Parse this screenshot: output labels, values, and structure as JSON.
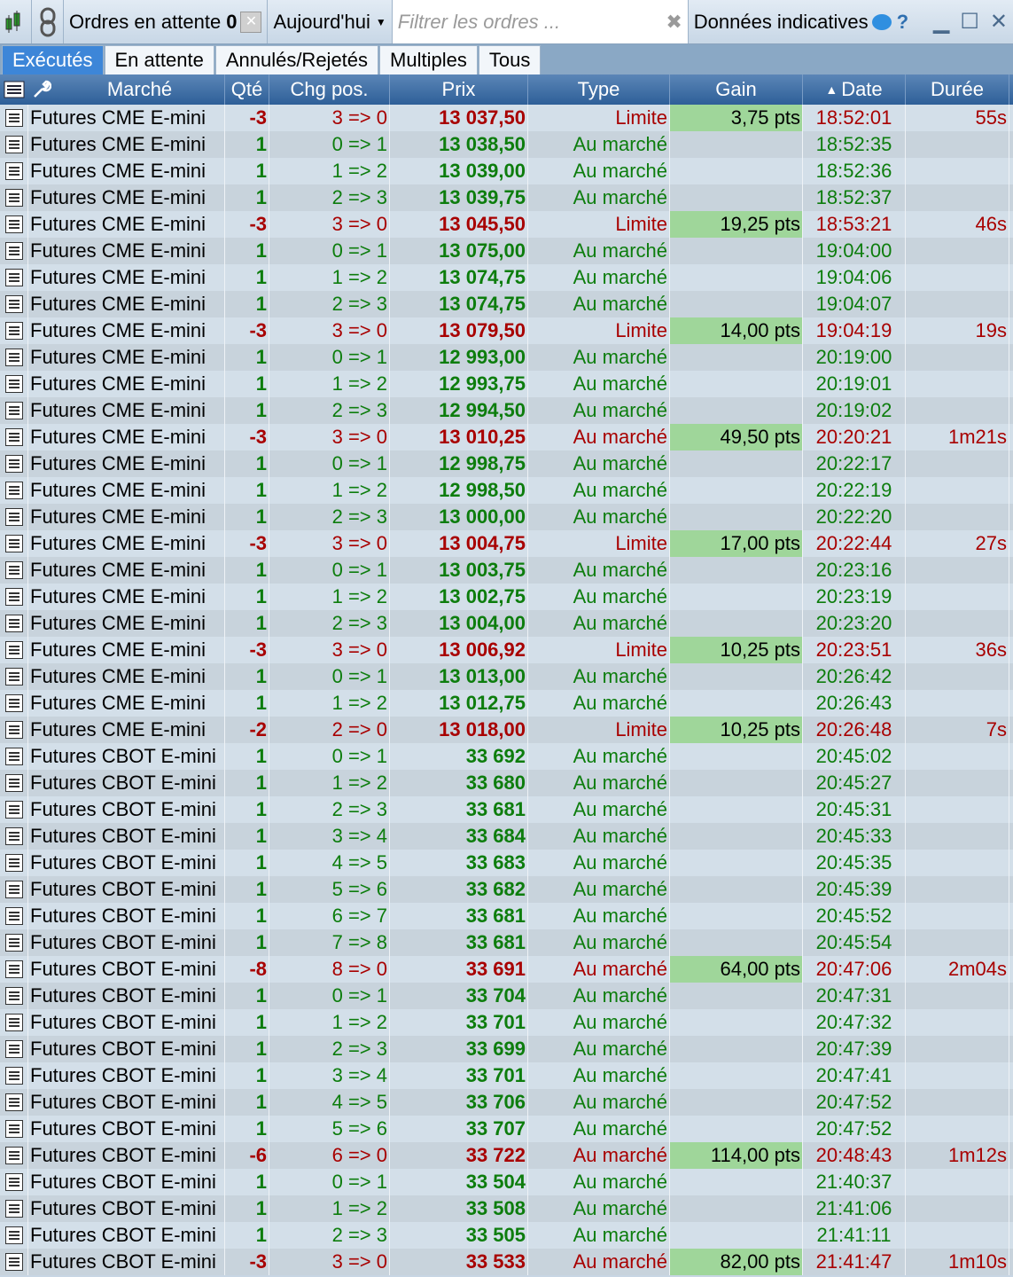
{
  "toolbar": {
    "pending_label": "Ordres en attente",
    "pending_count": "0",
    "period": "Aujourd'hui",
    "filter_placeholder": "Filtrer les ordres ...",
    "indicative": "Données indicatives"
  },
  "tabs": [
    "Exécutés",
    "En attente",
    "Annulés/Rejetés",
    "Multiples",
    "Tous"
  ],
  "columns": [
    "Marché",
    "Qté",
    "Chg pos.",
    "Prix",
    "Type",
    "Gain",
    "Date",
    "Durée"
  ],
  "sort_indicator": "▲",
  "colors": {
    "buy": "#0d7d0d",
    "sell": "#a80000",
    "gain_bg": "#9fd69a",
    "active_tab": "#3d86d8"
  },
  "rows": [
    {
      "market": "Futures CME E-mini",
      "qty": "-3",
      "chg": "3 => 0",
      "price": "13 037,50",
      "type": "Limite",
      "gain": "3,75 pts",
      "date": "18:52:01",
      "dur": "55s"
    },
    {
      "market": "Futures CME E-mini",
      "qty": "1",
      "chg": "0 => 1",
      "price": "13 038,50",
      "type": "Au marché",
      "gain": "",
      "date": "18:52:35",
      "dur": ""
    },
    {
      "market": "Futures CME E-mini",
      "qty": "1",
      "chg": "1 => 2",
      "price": "13 039,00",
      "type": "Au marché",
      "gain": "",
      "date": "18:52:36",
      "dur": ""
    },
    {
      "market": "Futures CME E-mini",
      "qty": "1",
      "chg": "2 => 3",
      "price": "13 039,75",
      "type": "Au marché",
      "gain": "",
      "date": "18:52:37",
      "dur": ""
    },
    {
      "market": "Futures CME E-mini",
      "qty": "-3",
      "chg": "3 => 0",
      "price": "13 045,50",
      "type": "Limite",
      "gain": "19,25 pts",
      "date": "18:53:21",
      "dur": "46s"
    },
    {
      "market": "Futures CME E-mini",
      "qty": "1",
      "chg": "0 => 1",
      "price": "13 075,00",
      "type": "Au marché",
      "gain": "",
      "date": "19:04:00",
      "dur": ""
    },
    {
      "market": "Futures CME E-mini",
      "qty": "1",
      "chg": "1 => 2",
      "price": "13 074,75",
      "type": "Au marché",
      "gain": "",
      "date": "19:04:06",
      "dur": ""
    },
    {
      "market": "Futures CME E-mini",
      "qty": "1",
      "chg": "2 => 3",
      "price": "13 074,75",
      "type": "Au marché",
      "gain": "",
      "date": "19:04:07",
      "dur": ""
    },
    {
      "market": "Futures CME E-mini",
      "qty": "-3",
      "chg": "3 => 0",
      "price": "13 079,50",
      "type": "Limite",
      "gain": "14,00 pts",
      "date": "19:04:19",
      "dur": "19s"
    },
    {
      "market": "Futures CME E-mini",
      "qty": "1",
      "chg": "0 => 1",
      "price": "12 993,00",
      "type": "Au marché",
      "gain": "",
      "date": "20:19:00",
      "dur": ""
    },
    {
      "market": "Futures CME E-mini",
      "qty": "1",
      "chg": "1 => 2",
      "price": "12 993,75",
      "type": "Au marché",
      "gain": "",
      "date": "20:19:01",
      "dur": ""
    },
    {
      "market": "Futures CME E-mini",
      "qty": "1",
      "chg": "2 => 3",
      "price": "12 994,50",
      "type": "Au marché",
      "gain": "",
      "date": "20:19:02",
      "dur": ""
    },
    {
      "market": "Futures CME E-mini",
      "qty": "-3",
      "chg": "3 => 0",
      "price": "13 010,25",
      "type": "Au marché",
      "gain": "49,50 pts",
      "date": "20:20:21",
      "dur": "1m21s"
    },
    {
      "market": "Futures CME E-mini",
      "qty": "1",
      "chg": "0 => 1",
      "price": "12 998,75",
      "type": "Au marché",
      "gain": "",
      "date": "20:22:17",
      "dur": ""
    },
    {
      "market": "Futures CME E-mini",
      "qty": "1",
      "chg": "1 => 2",
      "price": "12 998,50",
      "type": "Au marché",
      "gain": "",
      "date": "20:22:19",
      "dur": ""
    },
    {
      "market": "Futures CME E-mini",
      "qty": "1",
      "chg": "2 => 3",
      "price": "13 000,00",
      "type": "Au marché",
      "gain": "",
      "date": "20:22:20",
      "dur": ""
    },
    {
      "market": "Futures CME E-mini",
      "qty": "-3",
      "chg": "3 => 0",
      "price": "13 004,75",
      "type": "Limite",
      "gain": "17,00 pts",
      "date": "20:22:44",
      "dur": "27s"
    },
    {
      "market": "Futures CME E-mini",
      "qty": "1",
      "chg": "0 => 1",
      "price": "13 003,75",
      "type": "Au marché",
      "gain": "",
      "date": "20:23:16",
      "dur": ""
    },
    {
      "market": "Futures CME E-mini",
      "qty": "1",
      "chg": "1 => 2",
      "price": "13 002,75",
      "type": "Au marché",
      "gain": "",
      "date": "20:23:19",
      "dur": ""
    },
    {
      "market": "Futures CME E-mini",
      "qty": "1",
      "chg": "2 => 3",
      "price": "13 004,00",
      "type": "Au marché",
      "gain": "",
      "date": "20:23:20",
      "dur": ""
    },
    {
      "market": "Futures CME E-mini",
      "qty": "-3",
      "chg": "3 => 0",
      "price": "13 006,92",
      "type": "Limite",
      "gain": "10,25 pts",
      "date": "20:23:51",
      "dur": "36s"
    },
    {
      "market": "Futures CME E-mini",
      "qty": "1",
      "chg": "0 => 1",
      "price": "13 013,00",
      "type": "Au marché",
      "gain": "",
      "date": "20:26:42",
      "dur": ""
    },
    {
      "market": "Futures CME E-mini",
      "qty": "1",
      "chg": "1 => 2",
      "price": "13 012,75",
      "type": "Au marché",
      "gain": "",
      "date": "20:26:43",
      "dur": ""
    },
    {
      "market": "Futures CME E-mini",
      "qty": "-2",
      "chg": "2 => 0",
      "price": "13 018,00",
      "type": "Limite",
      "gain": "10,25 pts",
      "date": "20:26:48",
      "dur": "7s"
    },
    {
      "market": "Futures CBOT E-mini",
      "qty": "1",
      "chg": "0 => 1",
      "price": "33 692",
      "type": "Au marché",
      "gain": "",
      "date": "20:45:02",
      "dur": ""
    },
    {
      "market": "Futures CBOT E-mini",
      "qty": "1",
      "chg": "1 => 2",
      "price": "33 680",
      "type": "Au marché",
      "gain": "",
      "date": "20:45:27",
      "dur": ""
    },
    {
      "market": "Futures CBOT E-mini",
      "qty": "1",
      "chg": "2 => 3",
      "price": "33 681",
      "type": "Au marché",
      "gain": "",
      "date": "20:45:31",
      "dur": ""
    },
    {
      "market": "Futures CBOT E-mini",
      "qty": "1",
      "chg": "3 => 4",
      "price": "33 684",
      "type": "Au marché",
      "gain": "",
      "date": "20:45:33",
      "dur": ""
    },
    {
      "market": "Futures CBOT E-mini",
      "qty": "1",
      "chg": "4 => 5",
      "price": "33 683",
      "type": "Au marché",
      "gain": "",
      "date": "20:45:35",
      "dur": ""
    },
    {
      "market": "Futures CBOT E-mini",
      "qty": "1",
      "chg": "5 => 6",
      "price": "33 682",
      "type": "Au marché",
      "gain": "",
      "date": "20:45:39",
      "dur": ""
    },
    {
      "market": "Futures CBOT E-mini",
      "qty": "1",
      "chg": "6 => 7",
      "price": "33 681",
      "type": "Au marché",
      "gain": "",
      "date": "20:45:52",
      "dur": ""
    },
    {
      "market": "Futures CBOT E-mini",
      "qty": "1",
      "chg": "7 => 8",
      "price": "33 681",
      "type": "Au marché",
      "gain": "",
      "date": "20:45:54",
      "dur": ""
    },
    {
      "market": "Futures CBOT E-mini",
      "qty": "-8",
      "chg": "8 => 0",
      "price": "33 691",
      "type": "Au marché",
      "gain": "64,00 pts",
      "date": "20:47:06",
      "dur": "2m04s"
    },
    {
      "market": "Futures CBOT E-mini",
      "qty": "1",
      "chg": "0 => 1",
      "price": "33 704",
      "type": "Au marché",
      "gain": "",
      "date": "20:47:31",
      "dur": ""
    },
    {
      "market": "Futures CBOT E-mini",
      "qty": "1",
      "chg": "1 => 2",
      "price": "33 701",
      "type": "Au marché",
      "gain": "",
      "date": "20:47:32",
      "dur": ""
    },
    {
      "market": "Futures CBOT E-mini",
      "qty": "1",
      "chg": "2 => 3",
      "price": "33 699",
      "type": "Au marché",
      "gain": "",
      "date": "20:47:39",
      "dur": ""
    },
    {
      "market": "Futures CBOT E-mini",
      "qty": "1",
      "chg": "3 => 4",
      "price": "33 701",
      "type": "Au marché",
      "gain": "",
      "date": "20:47:41",
      "dur": ""
    },
    {
      "market": "Futures CBOT E-mini",
      "qty": "1",
      "chg": "4 => 5",
      "price": "33 706",
      "type": "Au marché",
      "gain": "",
      "date": "20:47:52",
      "dur": ""
    },
    {
      "market": "Futures CBOT E-mini",
      "qty": "1",
      "chg": "5 => 6",
      "price": "33 707",
      "type": "Au marché",
      "gain": "",
      "date": "20:47:52",
      "dur": ""
    },
    {
      "market": "Futures CBOT E-mini",
      "qty": "-6",
      "chg": "6 => 0",
      "price": "33 722",
      "type": "Au marché",
      "gain": "114,00 pts",
      "date": "20:48:43",
      "dur": "1m12s"
    },
    {
      "market": "Futures CBOT E-mini",
      "qty": "1",
      "chg": "0 => 1",
      "price": "33 504",
      "type": "Au marché",
      "gain": "",
      "date": "21:40:37",
      "dur": ""
    },
    {
      "market": "Futures CBOT E-mini",
      "qty": "1",
      "chg": "1 => 2",
      "price": "33 508",
      "type": "Au marché",
      "gain": "",
      "date": "21:41:06",
      "dur": ""
    },
    {
      "market": "Futures CBOT E-mini",
      "qty": "1",
      "chg": "2 => 3",
      "price": "33 505",
      "type": "Au marché",
      "gain": "",
      "date": "21:41:11",
      "dur": ""
    },
    {
      "market": "Futures CBOT E-mini",
      "qty": "-3",
      "chg": "3 => 0",
      "price": "33 533",
      "type": "Au marché",
      "gain": "82,00 pts",
      "date": "21:41:47",
      "dur": "1m10s"
    }
  ]
}
